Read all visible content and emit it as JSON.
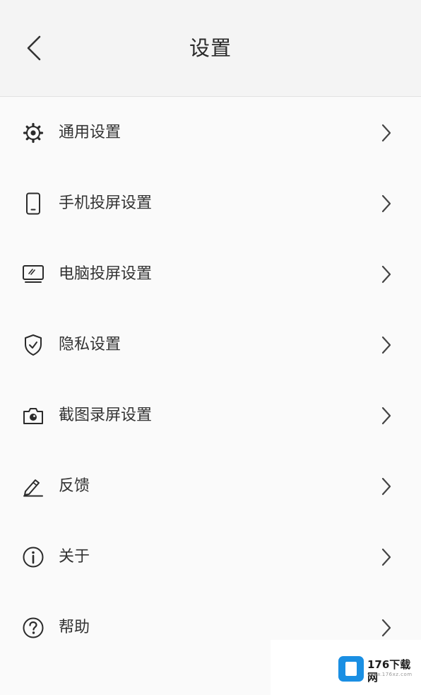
{
  "header": {
    "title": "设置",
    "back_icon": "chevron-left-icon"
  },
  "settings": {
    "items": [
      {
        "label": "通用设置",
        "icon": "gear-icon"
      },
      {
        "label": "手机投屏设置",
        "icon": "phone-icon"
      },
      {
        "label": "电脑投屏设置",
        "icon": "monitor-icon"
      },
      {
        "label": "隐私设置",
        "icon": "shield-check-icon"
      },
      {
        "label": "截图录屏设置",
        "icon": "camera-icon"
      },
      {
        "label": "反馈",
        "icon": "pencil-icon"
      },
      {
        "label": "关于",
        "icon": "info-icon"
      },
      {
        "label": "帮助",
        "icon": "help-icon"
      }
    ],
    "chevron_icon": "chevron-right-icon"
  },
  "watermark": {
    "brand": "176下载网",
    "sub": "www.176xz.com"
  },
  "colors": {
    "header_bg": "#f4f4f4",
    "page_bg": "#fafafa",
    "text": "#333333",
    "icon": "#2b2b2b",
    "watermark_blue": "#1a8fe3"
  }
}
